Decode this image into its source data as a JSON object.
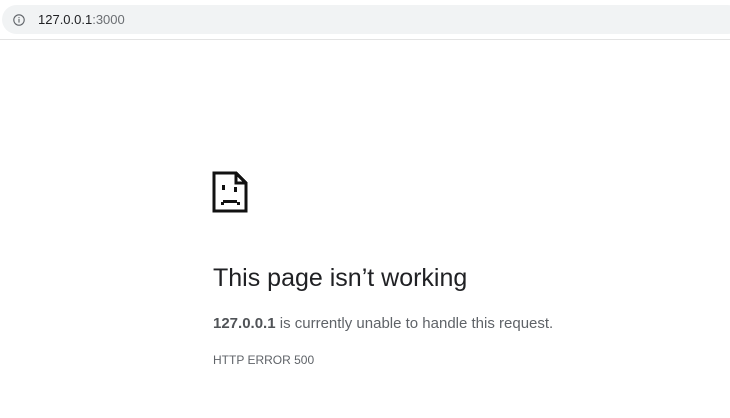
{
  "address_bar": {
    "host": "127.0.0.1",
    "port": ":3000",
    "icon": "info-icon"
  },
  "error": {
    "icon": "sad-page-icon",
    "heading": "This page isn’t working",
    "message_host": "127.0.0.1",
    "message_text": " is currently unable to handle this request.",
    "code": "HTTP ERROR 500"
  }
}
